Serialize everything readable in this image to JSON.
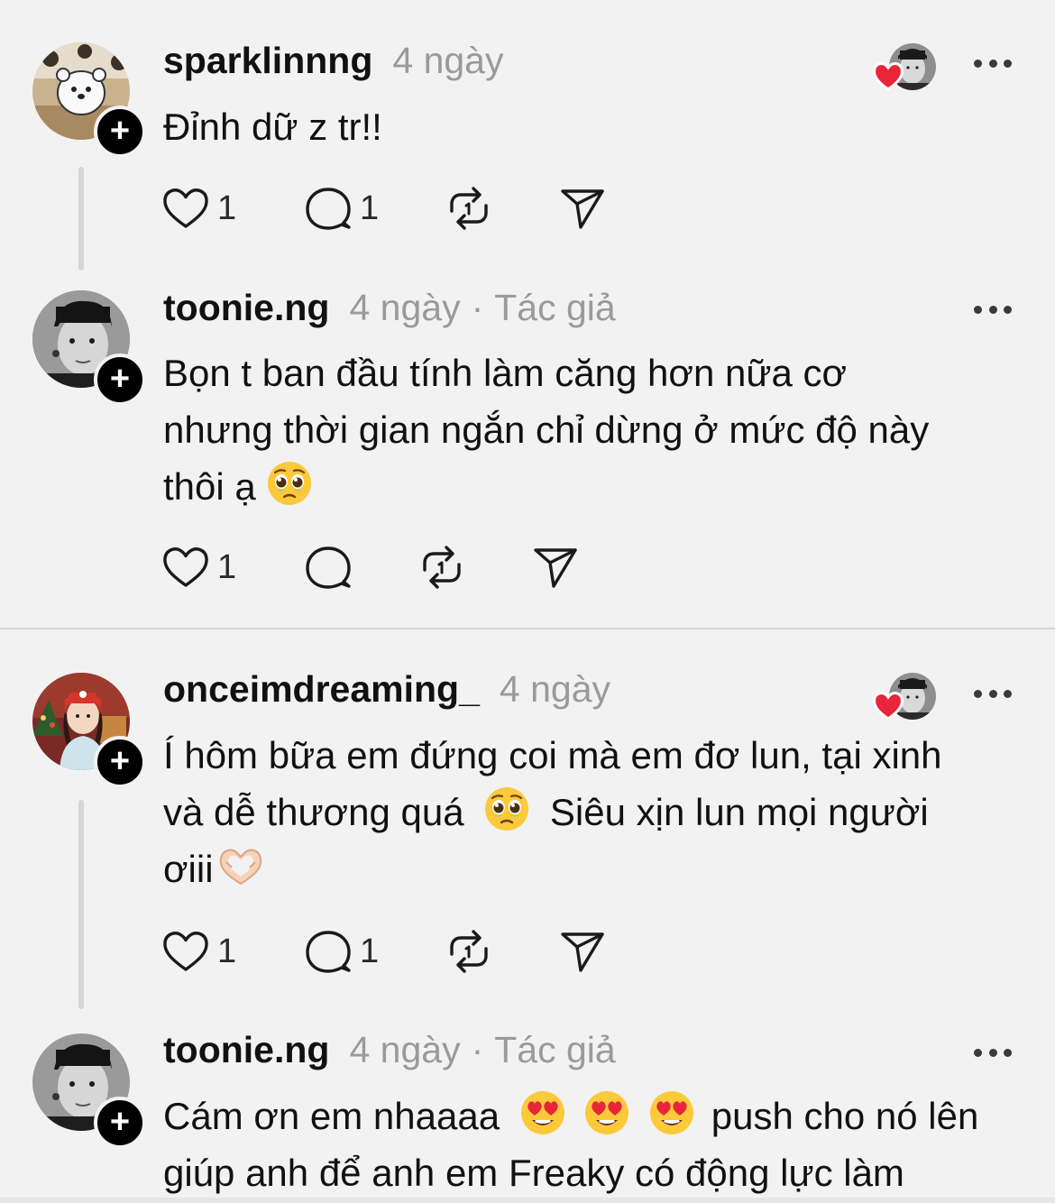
{
  "comments": [
    {
      "username": "sparklinnng",
      "time": "4 ngày",
      "text": "Đỉnh dữ z tr!!",
      "likes": "1",
      "replies": "1"
    },
    {
      "username": "toonie.ng",
      "time": "4 ngày",
      "author_tag": "Tác giả",
      "text_lines": [
        "Bọn t ban đầu tính làm căng hơn nữa cơ",
        "nhưng thời gian ngắn chỉ dừng ở mức độ này",
        "thôi ạ"
      ],
      "likes": "1"
    },
    {
      "username": "onceimdreaming_",
      "time": "4 ngày",
      "text_lines": [
        "Í hôm bữa em đứng coi mà em đơ lun, tại xinh",
        "và dễ thương quá",
        "Siêu xịn lun mọi người",
        "ơiii"
      ],
      "likes": "1",
      "replies": "1"
    },
    {
      "username": "toonie.ng",
      "time": "4 ngày",
      "author_tag": "Tác giả",
      "text_lines": [
        "Cám ơn em nhaaaa",
        "push cho nó lên",
        "giúp anh để anh em Freaky có động lực làm"
      ]
    }
  ],
  "separator": "·",
  "icons": {
    "like": "heart-outline-icon",
    "reply": "speech-bubble-icon",
    "repost": "repost-arrows-icon",
    "share": "paper-plane-icon",
    "more": "ellipsis-icon",
    "follow": "plus-icon",
    "liked_by_author": "red-heart-badge-icon"
  },
  "colors": {
    "background": "#f2f2f2",
    "text": "#111111",
    "muted": "#9a9a9a",
    "heart": "#e8253b",
    "divider": "#d4d4d4"
  }
}
